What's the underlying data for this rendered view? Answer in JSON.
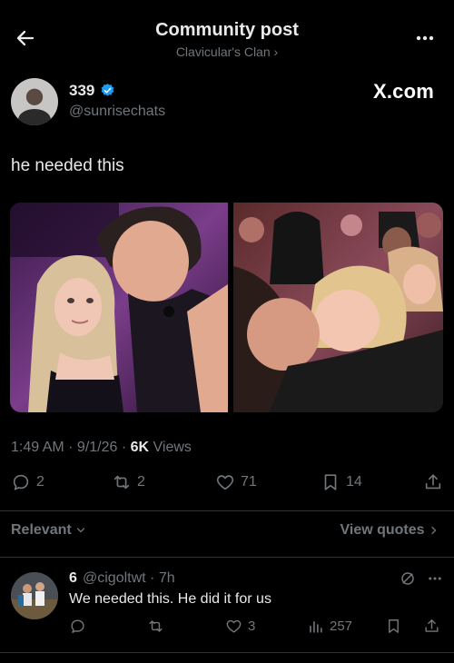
{
  "header": {
    "title": "Community post",
    "subtitle": "Clavicular's Clan ›"
  },
  "post": {
    "author": {
      "name": "339",
      "handle": "@sunrisechats"
    },
    "brand": "X.com",
    "text": "he needed this",
    "meta": {
      "time": "1:49 AM · 9/1/26 · ",
      "views_count": "6K",
      "views_label": " Views"
    },
    "actions": {
      "replies": "2",
      "reposts": "2",
      "likes": "71",
      "bookmarks": "14"
    }
  },
  "filters": {
    "sort_label": "Relevant",
    "view_quotes": "View quotes"
  },
  "reply": {
    "name": "6",
    "handle": "@cigoltwt · 7h",
    "text": "We needed this. He did it for us",
    "actions": {
      "likes": "3",
      "views": "257"
    }
  },
  "colors": {
    "background": "#000000",
    "text": "#e7e9ea",
    "muted": "#71767b",
    "verified": "#1d9bf0"
  }
}
